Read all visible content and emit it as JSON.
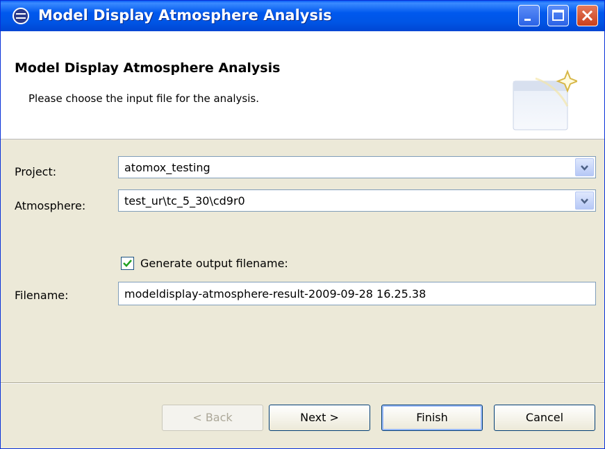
{
  "window": {
    "title": "Model Display Atmosphere Analysis",
    "controls": {
      "minimize_icon": "minimize-icon",
      "maximize_icon": "maximize-icon",
      "close_icon": "close-icon"
    }
  },
  "header": {
    "title": "Model Display Atmosphere Analysis",
    "subtitle": "Please choose the input file for the analysis."
  },
  "form": {
    "project": {
      "label": "Project:",
      "value": "atomox_testing"
    },
    "atmosphere": {
      "label": "Atmosphere:",
      "value": "test_ur\\tc_5_30\\cd9r0"
    },
    "generate_output": {
      "label": "Generate output filename:",
      "checked": true
    },
    "filename": {
      "label": "Filename:",
      "value": "modeldisplay-atmosphere-result-2009-09-28 16.25.38"
    }
  },
  "buttons": {
    "back": "< Back",
    "next": "Next >",
    "finish": "Finish",
    "cancel": "Cancel"
  },
  "colors": {
    "titlebar": "#0055e5",
    "dialog_bg": "#ece9d8",
    "checkmark": "#21a121"
  }
}
